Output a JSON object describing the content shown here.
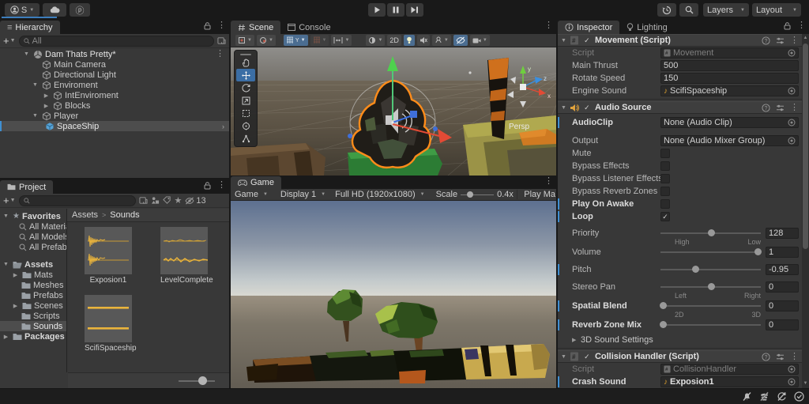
{
  "topbar": {
    "account": "S",
    "layers": "Layers",
    "layout": "Layout"
  },
  "hierarchy": {
    "tab": "Hierarchy",
    "search": "All",
    "items": [
      {
        "label": "Dam Thats Pretty*"
      },
      {
        "label": "Main Camera"
      },
      {
        "label": "Directional Light"
      },
      {
        "label": "Enviroment"
      },
      {
        "label": "IntEnviroment"
      },
      {
        "label": "Blocks"
      },
      {
        "label": "Player"
      },
      {
        "label": "SpaceShip"
      }
    ]
  },
  "project": {
    "tab": "Project",
    "favorites_label": "Favorites",
    "favorites": [
      {
        "label": "All Materials"
      },
      {
        "label": "All Models"
      },
      {
        "label": "All Prefabs"
      }
    ],
    "assets_label": "Assets",
    "folders": [
      {
        "label": "Mats"
      },
      {
        "label": "Meshes"
      },
      {
        "label": "Prefabs"
      },
      {
        "label": "Scenes"
      },
      {
        "label": "Scripts"
      },
      {
        "label": "Sounds"
      }
    ],
    "packages_label": "Packages",
    "breadcrumb": {
      "root": "Assets",
      "sep": ">",
      "current": "Sounds"
    },
    "files": [
      {
        "name": "Exposion1"
      },
      {
        "name": "LevelComplete"
      },
      {
        "name": "ScifiSpaceship"
      }
    ],
    "hidden_count": "13"
  },
  "scene": {
    "tab": "Scene",
    "console_tab": "Console",
    "btn_2d": "2D",
    "grid_axis": "Y",
    "persp": "Persp",
    "axis_x": "x",
    "axis_y": "y",
    "axis_z": "z"
  },
  "game": {
    "tab": "Game",
    "menu": "Game",
    "display": "Display 1",
    "resolution": "Full HD (1920x1080)",
    "scale_label": "Scale",
    "scale_value": "0.4x",
    "play_max": "Play Ma"
  },
  "inspector": {
    "tab": "Inspector",
    "lighting_tab": "Lighting",
    "movement": {
      "title": "Movement (Script)",
      "script_label": "Script",
      "script_value": "Movement",
      "thrust_label": "Main Thrust",
      "thrust_value": "500",
      "rotate_label": "Rotate Speed",
      "rotate_value": "150",
      "engine_label": "Engine Sound",
      "engine_value": "ScifiSpaceship"
    },
    "audio": {
      "title": "Audio Source",
      "clip_label": "AudioClip",
      "clip_value": "None (Audio Clip)",
      "output_label": "Output",
      "output_value": "None (Audio Mixer Group)",
      "checks": [
        {
          "label": "Mute",
          "mark": ""
        },
        {
          "label": "Bypass Effects",
          "mark": ""
        },
        {
          "label": "Bypass Listener Effects",
          "mark": ""
        },
        {
          "label": "Bypass Reverb Zones",
          "mark": ""
        },
        {
          "label": "Play On Awake",
          "mark": ""
        },
        {
          "label": "Loop",
          "mark": "✓"
        }
      ],
      "sliders": [
        {
          "label": "Priority",
          "value": "128",
          "pos": 0.5,
          "subl": "High",
          "subr": "Low"
        },
        {
          "label": "Volume",
          "value": "1",
          "pos": 0.97
        },
        {
          "label": "Pitch",
          "value": "-0.95",
          "pos": 0.345
        },
        {
          "label": "Stereo Pan",
          "value": "0",
          "pos": 0.5,
          "subl": "Left",
          "subr": "Right"
        },
        {
          "label": "Spatial Blend",
          "value": "0",
          "pos": 0.02,
          "subl": "2D",
          "subr": "3D"
        },
        {
          "label": "Reverb Zone Mix",
          "value": "0",
          "pos": 0.02
        }
      ],
      "foldout": "3D Sound Settings"
    },
    "collision": {
      "title": "Collision Handler (Script)",
      "script_label": "Script",
      "script_value": "CollisionHandler",
      "crash_label": "Crash Sound",
      "crash_value": "Exposion1"
    }
  }
}
